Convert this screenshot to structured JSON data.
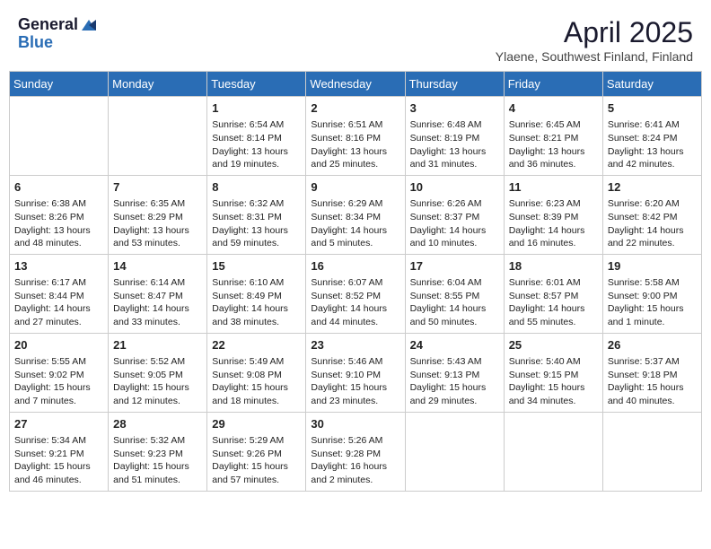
{
  "header": {
    "logo_general": "General",
    "logo_blue": "Blue",
    "month_title": "April 2025",
    "subtitle": "Ylaene, Southwest Finland, Finland"
  },
  "days_of_week": [
    "Sunday",
    "Monday",
    "Tuesday",
    "Wednesday",
    "Thursday",
    "Friday",
    "Saturday"
  ],
  "weeks": [
    [
      {
        "day": "",
        "info": ""
      },
      {
        "day": "",
        "info": ""
      },
      {
        "day": "1",
        "info": "Sunrise: 6:54 AM\nSunset: 8:14 PM\nDaylight: 13 hours and 19 minutes."
      },
      {
        "day": "2",
        "info": "Sunrise: 6:51 AM\nSunset: 8:16 PM\nDaylight: 13 hours and 25 minutes."
      },
      {
        "day": "3",
        "info": "Sunrise: 6:48 AM\nSunset: 8:19 PM\nDaylight: 13 hours and 31 minutes."
      },
      {
        "day": "4",
        "info": "Sunrise: 6:45 AM\nSunset: 8:21 PM\nDaylight: 13 hours and 36 minutes."
      },
      {
        "day": "5",
        "info": "Sunrise: 6:41 AM\nSunset: 8:24 PM\nDaylight: 13 hours and 42 minutes."
      }
    ],
    [
      {
        "day": "6",
        "info": "Sunrise: 6:38 AM\nSunset: 8:26 PM\nDaylight: 13 hours and 48 minutes."
      },
      {
        "day": "7",
        "info": "Sunrise: 6:35 AM\nSunset: 8:29 PM\nDaylight: 13 hours and 53 minutes."
      },
      {
        "day": "8",
        "info": "Sunrise: 6:32 AM\nSunset: 8:31 PM\nDaylight: 13 hours and 59 minutes."
      },
      {
        "day": "9",
        "info": "Sunrise: 6:29 AM\nSunset: 8:34 PM\nDaylight: 14 hours and 5 minutes."
      },
      {
        "day": "10",
        "info": "Sunrise: 6:26 AM\nSunset: 8:37 PM\nDaylight: 14 hours and 10 minutes."
      },
      {
        "day": "11",
        "info": "Sunrise: 6:23 AM\nSunset: 8:39 PM\nDaylight: 14 hours and 16 minutes."
      },
      {
        "day": "12",
        "info": "Sunrise: 6:20 AM\nSunset: 8:42 PM\nDaylight: 14 hours and 22 minutes."
      }
    ],
    [
      {
        "day": "13",
        "info": "Sunrise: 6:17 AM\nSunset: 8:44 PM\nDaylight: 14 hours and 27 minutes."
      },
      {
        "day": "14",
        "info": "Sunrise: 6:14 AM\nSunset: 8:47 PM\nDaylight: 14 hours and 33 minutes."
      },
      {
        "day": "15",
        "info": "Sunrise: 6:10 AM\nSunset: 8:49 PM\nDaylight: 14 hours and 38 minutes."
      },
      {
        "day": "16",
        "info": "Sunrise: 6:07 AM\nSunset: 8:52 PM\nDaylight: 14 hours and 44 minutes."
      },
      {
        "day": "17",
        "info": "Sunrise: 6:04 AM\nSunset: 8:55 PM\nDaylight: 14 hours and 50 minutes."
      },
      {
        "day": "18",
        "info": "Sunrise: 6:01 AM\nSunset: 8:57 PM\nDaylight: 14 hours and 55 minutes."
      },
      {
        "day": "19",
        "info": "Sunrise: 5:58 AM\nSunset: 9:00 PM\nDaylight: 15 hours and 1 minute."
      }
    ],
    [
      {
        "day": "20",
        "info": "Sunrise: 5:55 AM\nSunset: 9:02 PM\nDaylight: 15 hours and 7 minutes."
      },
      {
        "day": "21",
        "info": "Sunrise: 5:52 AM\nSunset: 9:05 PM\nDaylight: 15 hours and 12 minutes."
      },
      {
        "day": "22",
        "info": "Sunrise: 5:49 AM\nSunset: 9:08 PM\nDaylight: 15 hours and 18 minutes."
      },
      {
        "day": "23",
        "info": "Sunrise: 5:46 AM\nSunset: 9:10 PM\nDaylight: 15 hours and 23 minutes."
      },
      {
        "day": "24",
        "info": "Sunrise: 5:43 AM\nSunset: 9:13 PM\nDaylight: 15 hours and 29 minutes."
      },
      {
        "day": "25",
        "info": "Sunrise: 5:40 AM\nSunset: 9:15 PM\nDaylight: 15 hours and 34 minutes."
      },
      {
        "day": "26",
        "info": "Sunrise: 5:37 AM\nSunset: 9:18 PM\nDaylight: 15 hours and 40 minutes."
      }
    ],
    [
      {
        "day": "27",
        "info": "Sunrise: 5:34 AM\nSunset: 9:21 PM\nDaylight: 15 hours and 46 minutes."
      },
      {
        "day": "28",
        "info": "Sunrise: 5:32 AM\nSunset: 9:23 PM\nDaylight: 15 hours and 51 minutes."
      },
      {
        "day": "29",
        "info": "Sunrise: 5:29 AM\nSunset: 9:26 PM\nDaylight: 15 hours and 57 minutes."
      },
      {
        "day": "30",
        "info": "Sunrise: 5:26 AM\nSunset: 9:28 PM\nDaylight: 16 hours and 2 minutes."
      },
      {
        "day": "",
        "info": ""
      },
      {
        "day": "",
        "info": ""
      },
      {
        "day": "",
        "info": ""
      }
    ]
  ]
}
